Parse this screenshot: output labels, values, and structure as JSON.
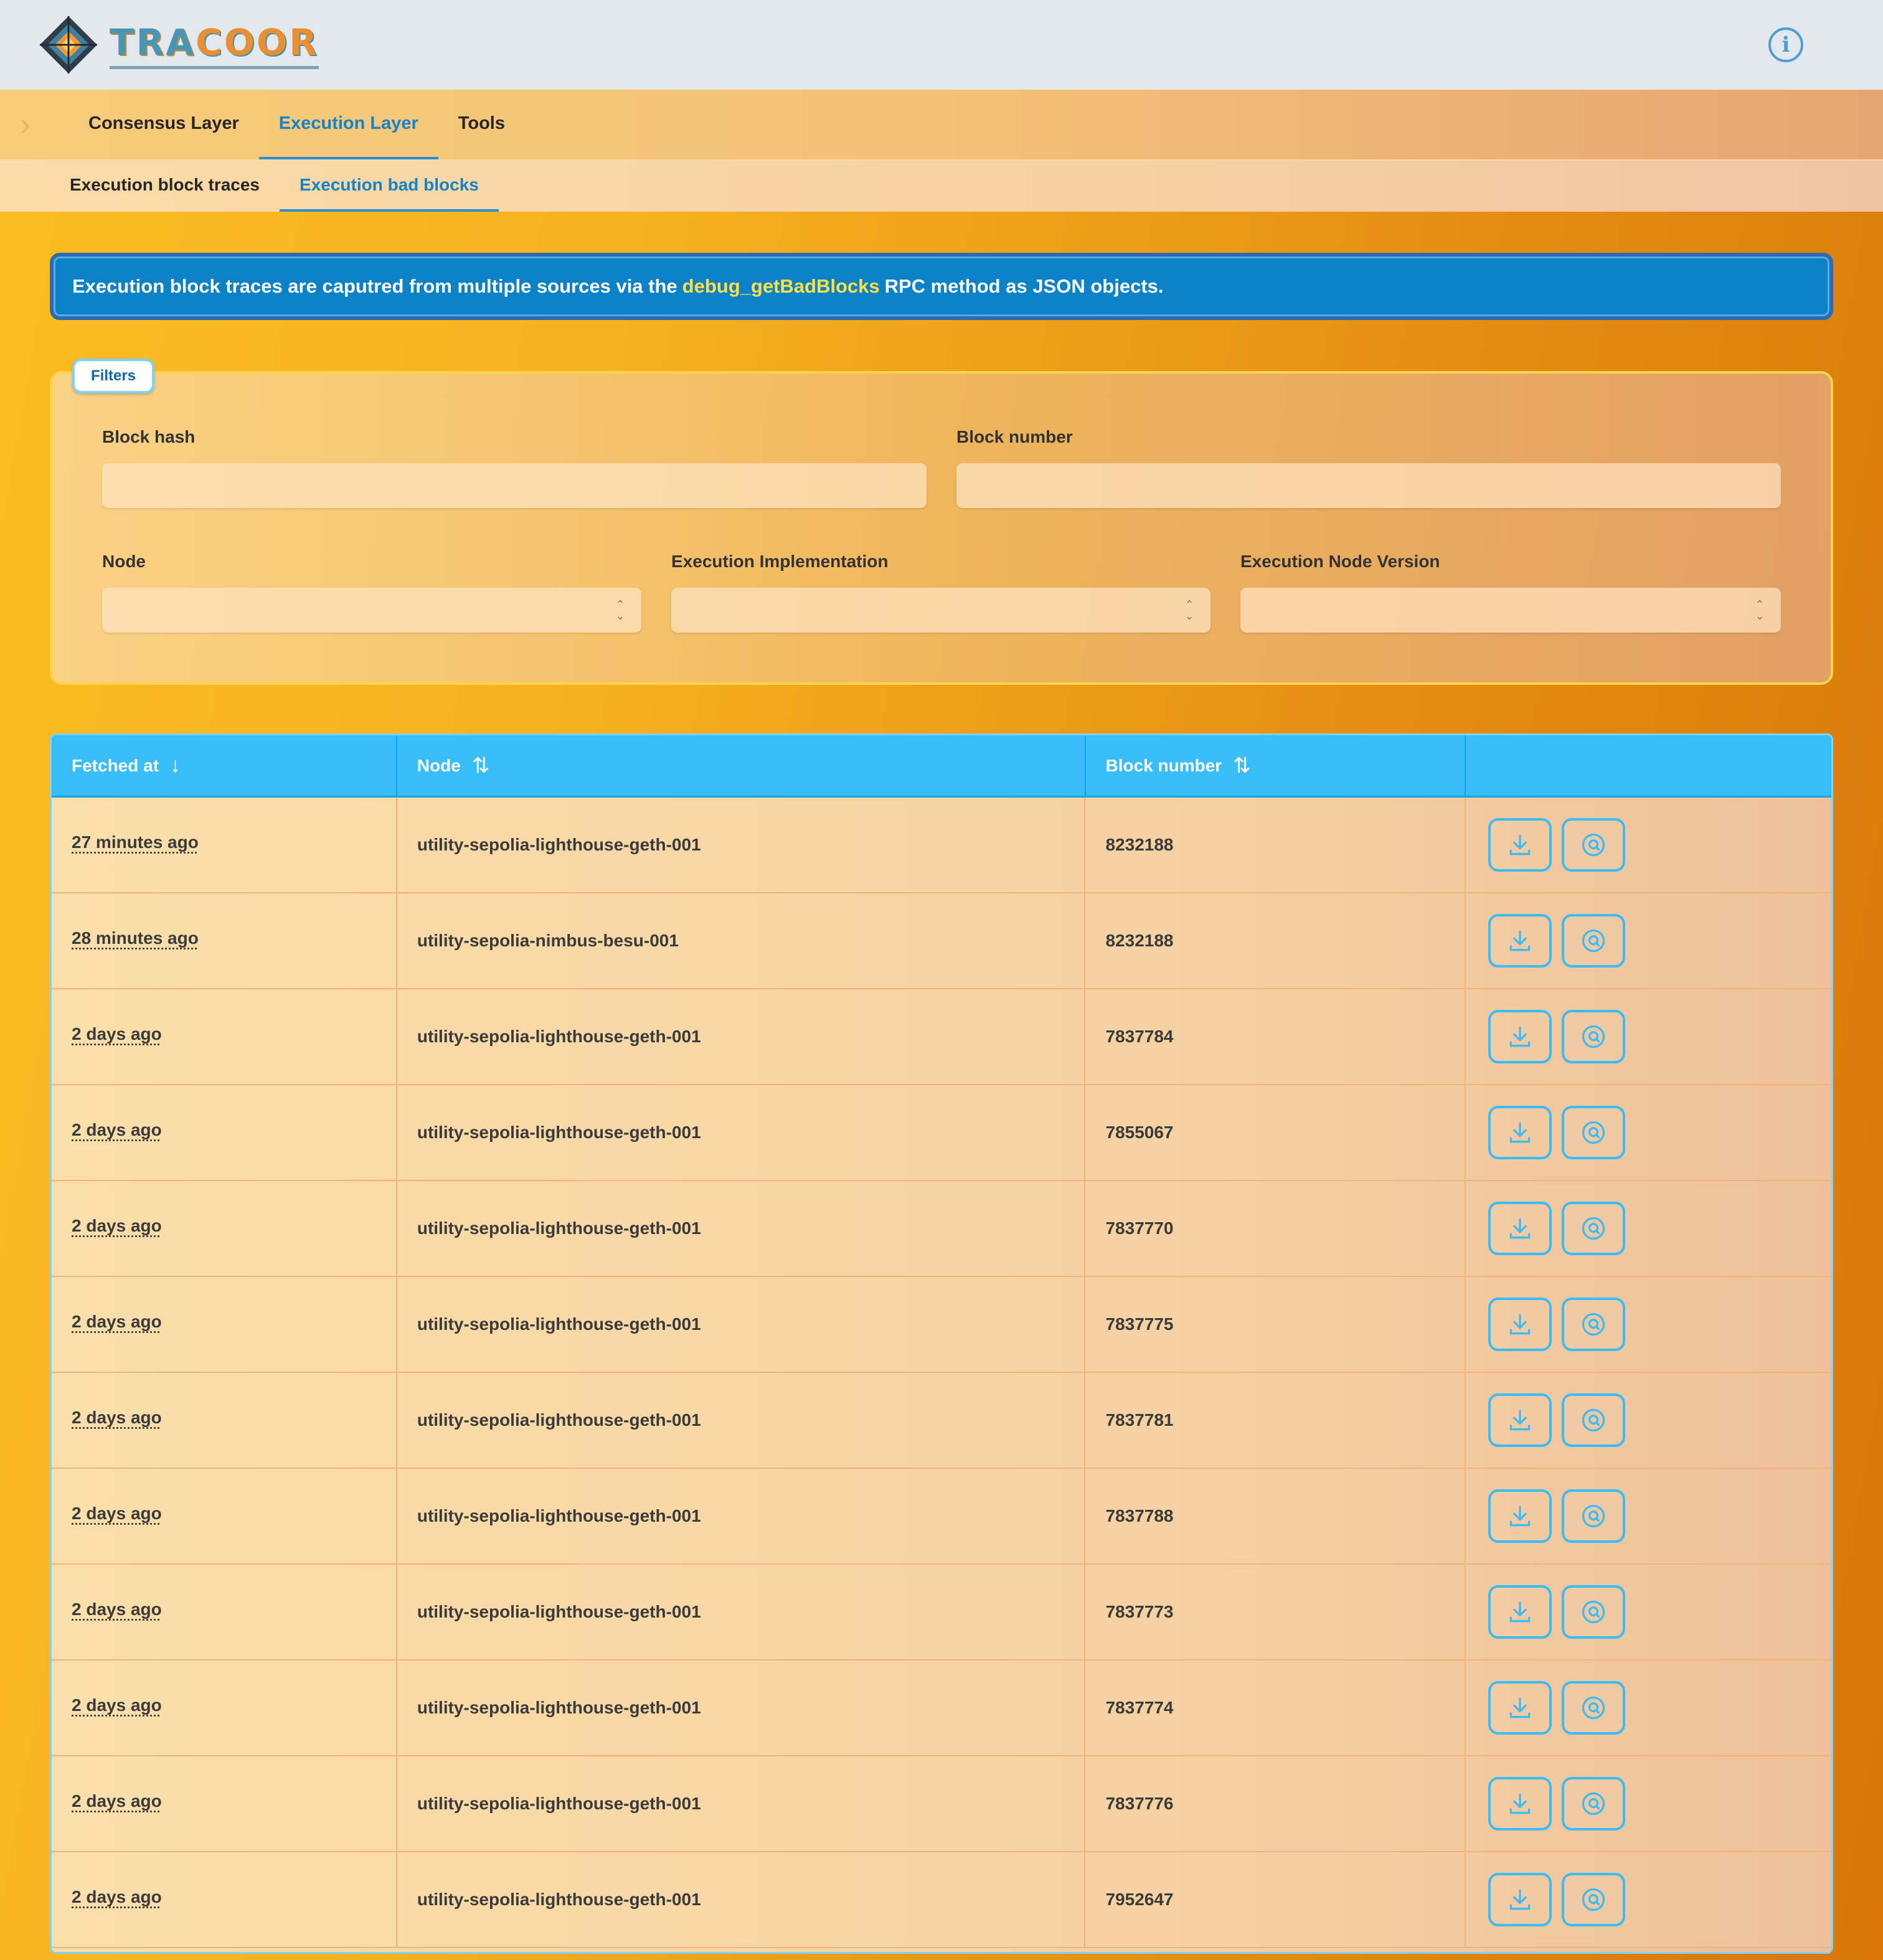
{
  "app": {
    "logo_text_a": "TRA",
    "logo_text_b": "COOR"
  },
  "header": {
    "info_icon": "info-icon"
  },
  "nav": {
    "tabs": [
      {
        "label": "Consensus Layer",
        "active": false
      },
      {
        "label": "Execution Layer",
        "active": true
      },
      {
        "label": "Tools",
        "active": false
      }
    ],
    "subtabs": [
      {
        "label": "Execution block traces",
        "active": false
      },
      {
        "label": "Execution bad blocks",
        "active": true
      }
    ]
  },
  "banner": {
    "text_before": "Execution block traces are caputred from multiple sources via the",
    "highlight": "debug_getBadBlocks",
    "text_after": "RPC method as JSON objects."
  },
  "filters": {
    "badge": "Filters",
    "block_hash": {
      "label": "Block hash",
      "value": ""
    },
    "block_number": {
      "label": "Block number",
      "value": ""
    },
    "node": {
      "label": "Node",
      "value": ""
    },
    "execution_implementation": {
      "label": "Execution Implementation",
      "value": ""
    },
    "execution_node_version": {
      "label": "Execution Node Version",
      "value": ""
    }
  },
  "table": {
    "columns": [
      "Fetched at",
      "Node",
      "Block number",
      ""
    ],
    "rows": [
      {
        "fetched_at": "27 minutes ago",
        "node": "utility-sepolia-lighthouse-geth-001",
        "block_number": "8232188"
      },
      {
        "fetched_at": "28 minutes ago",
        "node": "utility-sepolia-nimbus-besu-001",
        "block_number": "8232188"
      },
      {
        "fetched_at": "2 days ago",
        "node": "utility-sepolia-lighthouse-geth-001",
        "block_number": "7837784"
      },
      {
        "fetched_at": "2 days ago",
        "node": "utility-sepolia-lighthouse-geth-001",
        "block_number": "7855067"
      },
      {
        "fetched_at": "2 days ago",
        "node": "utility-sepolia-lighthouse-geth-001",
        "block_number": "7837770"
      },
      {
        "fetched_at": "2 days ago",
        "node": "utility-sepolia-lighthouse-geth-001",
        "block_number": "7837775"
      },
      {
        "fetched_at": "2 days ago",
        "node": "utility-sepolia-lighthouse-geth-001",
        "block_number": "7837781"
      },
      {
        "fetched_at": "2 days ago",
        "node": "utility-sepolia-lighthouse-geth-001",
        "block_number": "7837788"
      },
      {
        "fetched_at": "2 days ago",
        "node": "utility-sepolia-lighthouse-geth-001",
        "block_number": "7837773"
      },
      {
        "fetched_at": "2 days ago",
        "node": "utility-sepolia-lighthouse-geth-001",
        "block_number": "7837774"
      },
      {
        "fetched_at": "2 days ago",
        "node": "utility-sepolia-lighthouse-geth-001",
        "block_number": "7837776"
      },
      {
        "fetched_at": "2 days ago",
        "node": "utility-sepolia-lighthouse-geth-001",
        "block_number": "7952647"
      }
    ]
  },
  "colors": {
    "accent": "#38bdf8",
    "banner": "#0b82c7",
    "highlight": "#fde047"
  }
}
